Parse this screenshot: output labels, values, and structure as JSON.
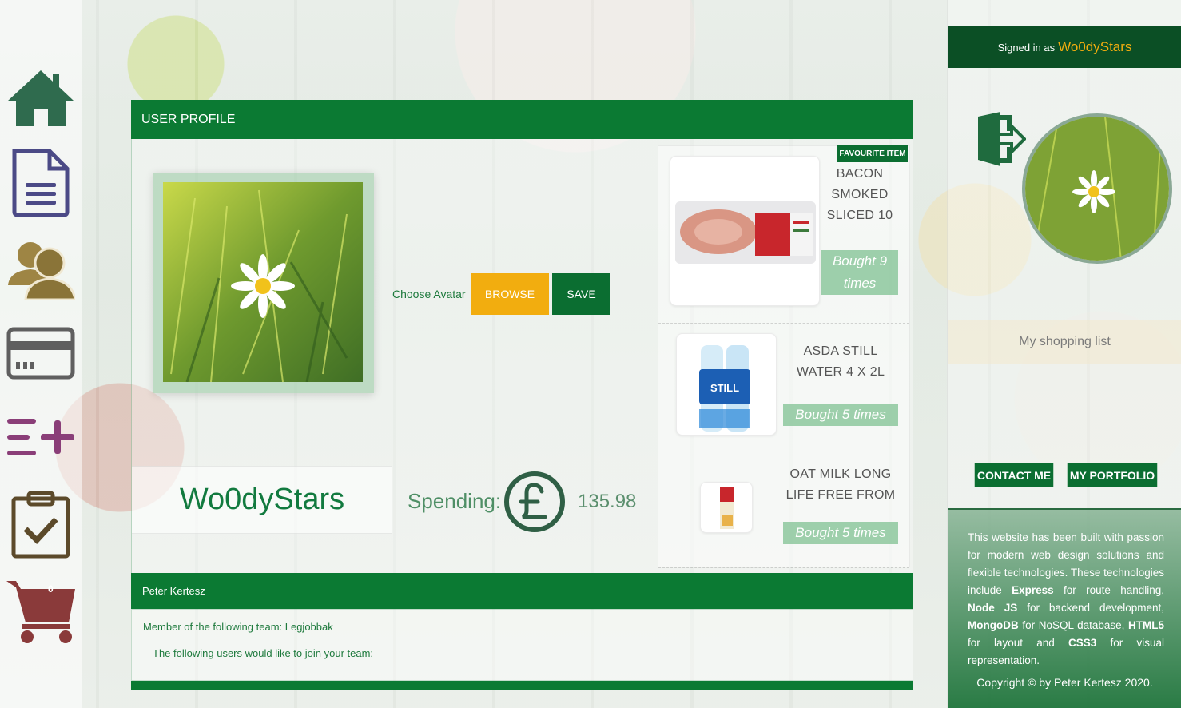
{
  "nav": {
    "cart_count": "0"
  },
  "profile": {
    "header": "USER PROFILE",
    "choose_avatar": "Choose Avatar",
    "browse": "BROWSE",
    "save": "SAVE",
    "username": "Wo0dyStars",
    "spending_label": "Spending:",
    "spending_value": "135.98"
  },
  "favourites": {
    "badge": "FAVOURITE ITEM",
    "items": [
      {
        "name": "BACON SMOKED SLICED 10",
        "count": "Bought 9 times"
      },
      {
        "name": "ASDA STILL WATER 4 X 2L",
        "count": "Bought 5 times"
      },
      {
        "name": "OAT MILK LONG LIFE FREE FROM",
        "count": "Bought 5 times"
      }
    ]
  },
  "team": {
    "owner": "Peter Kertesz",
    "member_line": "Member of the following team: Legjobbak",
    "join_line": "The following users would like to join your team:"
  },
  "sidebar": {
    "signed_in_prefix": "Signed in as",
    "signed_in_user": "Wo0dyStars",
    "shopping_list": "My shopping list",
    "contact": "CONTACT ME",
    "portfolio": "MY PORTFOLIO",
    "footer_parts": {
      "p1": "This website has been built with passion for modern web design solutions and flexible technologies. These technologies include ",
      "express": "Express",
      "p2": " for route handling, ",
      "node": "Node JS",
      "p3": " for backend development, ",
      "mongo": "MongoDB",
      "p4": " for NoSQL database, ",
      "html": "HTML5",
      "p5": " for layout and ",
      "css": "CSS3",
      "p6": " for visual representation."
    },
    "copyright": "Copyright © by Peter Kertesz 2020."
  },
  "colors": {
    "primary_green": "#0b7a33",
    "accent_orange": "#f2ad0f",
    "dark_green": "#0b4f25"
  }
}
